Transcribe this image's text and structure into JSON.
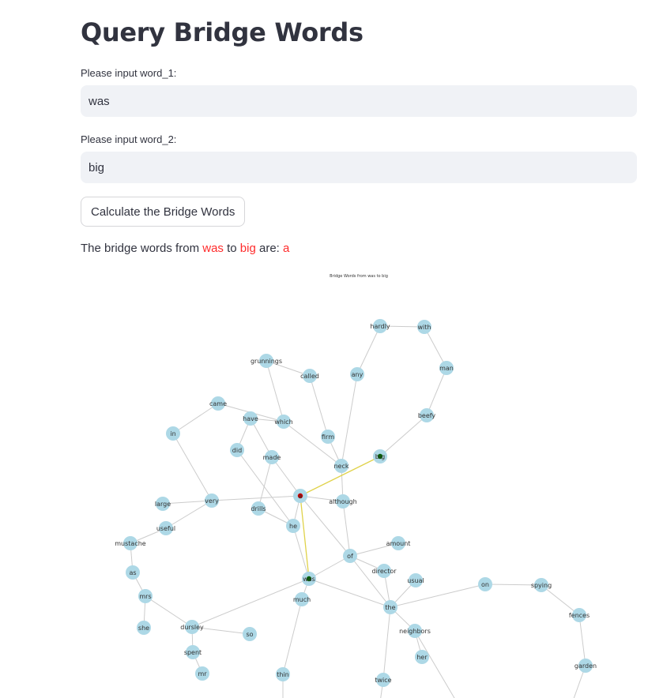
{
  "page": {
    "title": "Query Bridge Words",
    "word1_label": "Please input word_1:",
    "word1_value": "was",
    "word2_label": "Please input word_2:",
    "word2_value": "big",
    "button_label": "Calculate the Bridge Words",
    "result_prefix": "The bridge words from ",
    "result_word1": "was",
    "result_mid": " to ",
    "result_word2": "big",
    "result_suffix": " are: ",
    "result_bridge": "a"
  },
  "graph": {
    "title": "Bridge Words from was to big",
    "colors": {
      "node": "#add8e6",
      "edge": "#cccccc",
      "bridge_edge": "#e0d24a",
      "bridge_node": "#cc0000",
      "endpoint_node": "#006400",
      "label": "#333333"
    },
    "nodes": [
      {
        "id": "hardly",
        "label": "hardly"
      },
      {
        "id": "with",
        "label": "with"
      },
      {
        "id": "man",
        "label": "man"
      },
      {
        "id": "grunnings",
        "label": "grunnings"
      },
      {
        "id": "called",
        "label": "called"
      },
      {
        "id": "any",
        "label": "any"
      },
      {
        "id": "came",
        "label": "came"
      },
      {
        "id": "have",
        "label": "have"
      },
      {
        "id": "which",
        "label": "which"
      },
      {
        "id": "beefy",
        "label": "beefy"
      },
      {
        "id": "in",
        "label": "in"
      },
      {
        "id": "firm",
        "label": "firm"
      },
      {
        "id": "did",
        "label": "did"
      },
      {
        "id": "made",
        "label": "made"
      },
      {
        "id": "big",
        "label": "big",
        "role": "endpoint"
      },
      {
        "id": "neck",
        "label": "neck"
      },
      {
        "id": "a",
        "label": "a",
        "role": "bridge"
      },
      {
        "id": "large",
        "label": "large"
      },
      {
        "id": "very",
        "label": "very"
      },
      {
        "id": "drills",
        "label": "drills"
      },
      {
        "id": "although",
        "label": "although"
      },
      {
        "id": "he",
        "label": "he"
      },
      {
        "id": "useful",
        "label": "useful"
      },
      {
        "id": "mustache",
        "label": "mustache"
      },
      {
        "id": "amount",
        "label": "amount"
      },
      {
        "id": "of",
        "label": "of"
      },
      {
        "id": "as",
        "label": "as"
      },
      {
        "id": "director",
        "label": "director"
      },
      {
        "id": "was",
        "label": "was",
        "role": "endpoint"
      },
      {
        "id": "usual",
        "label": "usual"
      },
      {
        "id": "on",
        "label": "on"
      },
      {
        "id": "spying",
        "label": "spying"
      },
      {
        "id": "mrs",
        "label": "mrs"
      },
      {
        "id": "much",
        "label": "much"
      },
      {
        "id": "the",
        "label": "the"
      },
      {
        "id": "fences",
        "label": "fences"
      },
      {
        "id": "she",
        "label": "she"
      },
      {
        "id": "dursley",
        "label": "dursley"
      },
      {
        "id": "neighbors",
        "label": "neighbors"
      },
      {
        "id": "so",
        "label": "so"
      },
      {
        "id": "spent",
        "label": "spent"
      },
      {
        "id": "her",
        "label": "her"
      },
      {
        "id": "garden",
        "label": "garden"
      },
      {
        "id": "mr",
        "label": "mr"
      },
      {
        "id": "thin",
        "label": "thin"
      },
      {
        "id": "twice",
        "label": "twice"
      }
    ],
    "edges": [
      [
        "hardly",
        "with"
      ],
      [
        "with",
        "man"
      ],
      [
        "man",
        "beefy"
      ],
      [
        "beefy",
        "big"
      ],
      [
        "hardly",
        "any"
      ],
      [
        "any",
        "neck"
      ],
      [
        "grunnings",
        "called"
      ],
      [
        "grunnings",
        "which"
      ],
      [
        "called",
        "firm"
      ],
      [
        "firm",
        "neck"
      ],
      [
        "came",
        "in"
      ],
      [
        "came",
        "which"
      ],
      [
        "have",
        "which"
      ],
      [
        "have",
        "did"
      ],
      [
        "have",
        "made"
      ],
      [
        "which",
        "neck"
      ],
      [
        "did",
        "he"
      ],
      [
        "made",
        "drills"
      ],
      [
        "made",
        "a"
      ],
      [
        "neck",
        "although"
      ],
      [
        "in",
        "very"
      ],
      [
        "large",
        "very"
      ],
      [
        "very",
        "a"
      ],
      [
        "very",
        "useful"
      ],
      [
        "useful",
        "mustache"
      ],
      [
        "mustache",
        "as"
      ],
      [
        "as",
        "mrs"
      ],
      [
        "mrs",
        "she"
      ],
      [
        "mrs",
        "dursley"
      ],
      [
        "drills",
        "he"
      ],
      [
        "a",
        "he"
      ],
      [
        "a",
        "although"
      ],
      [
        "a",
        "of"
      ],
      [
        "although",
        "of"
      ],
      [
        "he",
        "was"
      ],
      [
        "of",
        "amount"
      ],
      [
        "of",
        "director"
      ],
      [
        "of",
        "was"
      ],
      [
        "of",
        "the"
      ],
      [
        "director",
        "the"
      ],
      [
        "usual",
        "the"
      ],
      [
        "was",
        "the"
      ],
      [
        "was",
        "much"
      ],
      [
        "was",
        "dursley"
      ],
      [
        "the",
        "on"
      ],
      [
        "on",
        "spying"
      ],
      [
        "spying",
        "fences"
      ],
      [
        "fences",
        "garden"
      ],
      [
        "the",
        "neighbors"
      ],
      [
        "the",
        "twice"
      ],
      [
        "neighbors",
        "her"
      ],
      [
        "dursley",
        "spent"
      ],
      [
        "dursley",
        "so"
      ],
      [
        "spent",
        "mr"
      ],
      [
        "much",
        "thin"
      ]
    ],
    "bridge_edges": [
      [
        "was",
        "a"
      ],
      [
        "a",
        "big"
      ]
    ]
  }
}
